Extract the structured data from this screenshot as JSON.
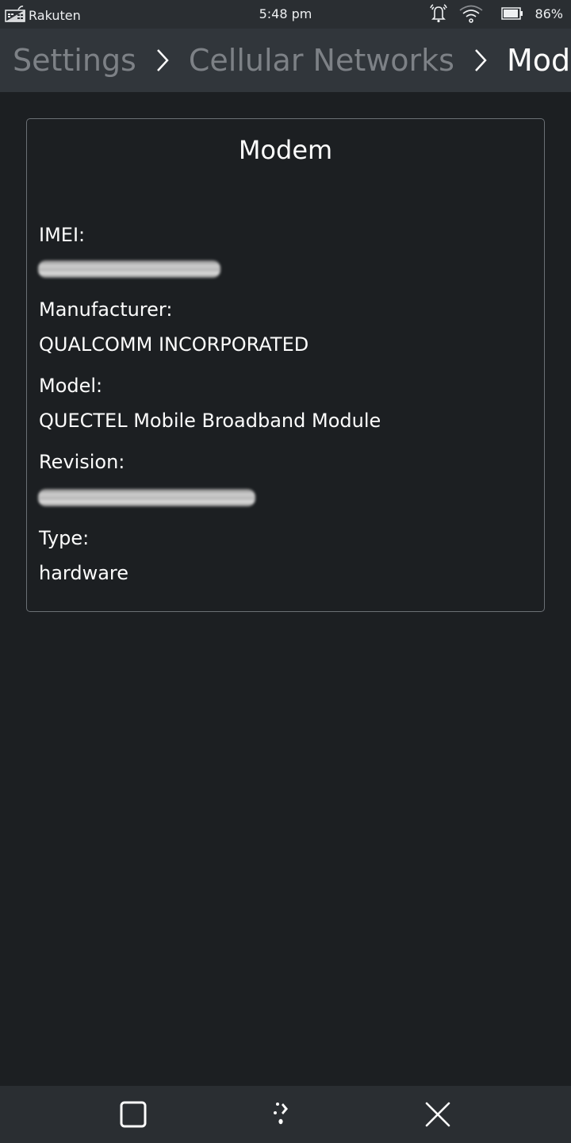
{
  "status_bar": {
    "carrier": "Rakuten",
    "time": "5:48 pm",
    "battery_percent": "86%",
    "battery_level": 0.86,
    "icons": [
      "sim-card-icon",
      "alarm-icon",
      "wifi-icon",
      "battery-icon"
    ]
  },
  "breadcrumb": {
    "items": [
      "Settings",
      "Cellular Networks",
      "Modem"
    ]
  },
  "modem_card": {
    "title": "Modem",
    "fields": [
      {
        "label": "IMEI:",
        "value": null,
        "redacted": true
      },
      {
        "label": "Manufacturer:",
        "value": "QUALCOMM INCORPORATED",
        "redacted": false
      },
      {
        "label": "Model:",
        "value": "QUECTEL Mobile Broadband Module",
        "redacted": false
      },
      {
        "label": "Revision:",
        "value": null,
        "redacted": true
      },
      {
        "label": "Type:",
        "value": "hardware",
        "redacted": false
      }
    ]
  },
  "nav_bar": {
    "buttons": [
      "task-switcher",
      "home",
      "close"
    ]
  }
}
